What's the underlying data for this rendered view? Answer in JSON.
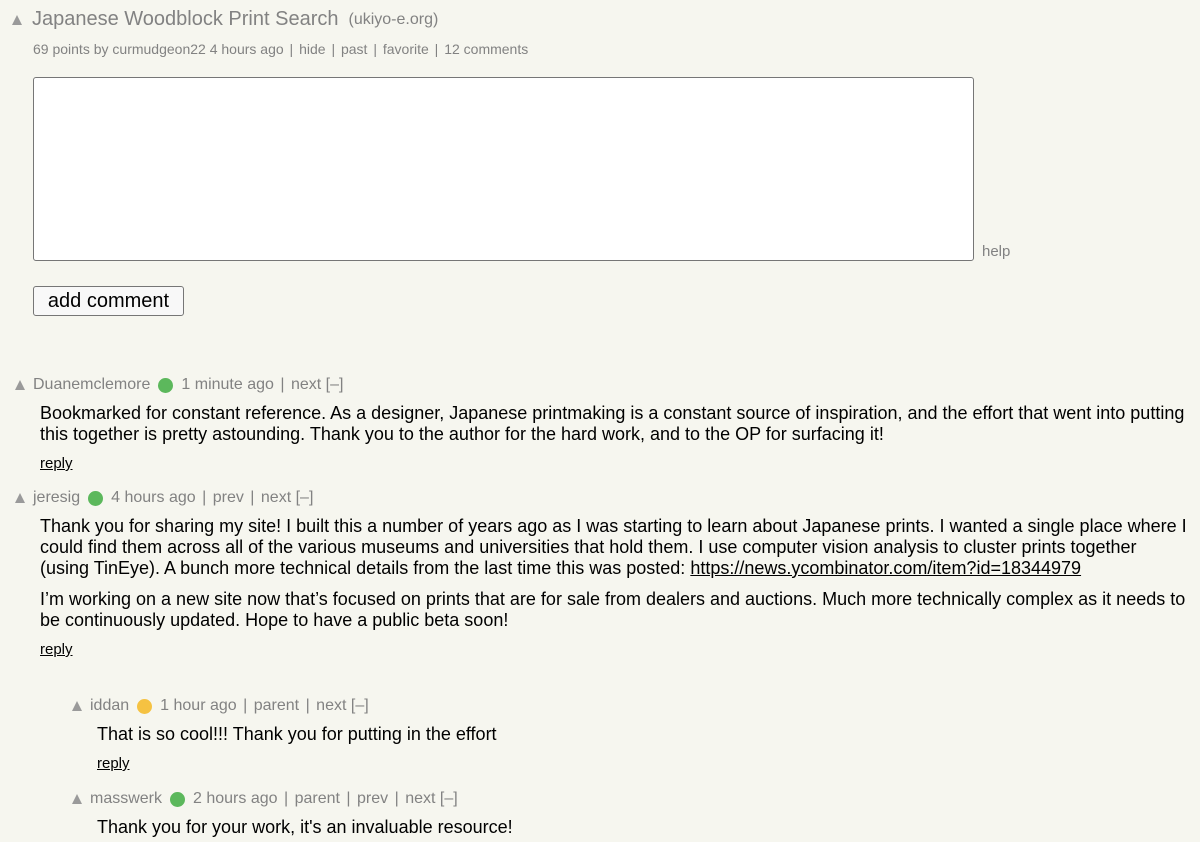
{
  "story": {
    "title": "Japanese Woodblock Print Search",
    "domain": "(ukiyo-e.org)",
    "points": "69 points",
    "by_label": "by",
    "author": "curmudgeon22",
    "age": "4 hours ago",
    "links": [
      "hide",
      "past",
      "favorite",
      "12 comments"
    ]
  },
  "form": {
    "textarea_value": "",
    "help_label": "help",
    "submit_label": "add comment"
  },
  "comments": [
    {
      "user": "Duanemclemore",
      "dot_color": "#5cb85c",
      "age": "1 minute ago",
      "nav": [
        "next",
        "[–]"
      ],
      "paragraphs": [
        "Bookmarked for constant reference. As a designer, Japanese printmaking is a constant source of inspiration, and the effort that went into putting this together is pretty astounding. Thank you to the author for the hard work, and to the OP for surfacing it!"
      ],
      "reply": "reply"
    },
    {
      "user": "jeresig",
      "dot_color": "#5cb85c",
      "age": "4 hours ago",
      "nav": [
        "prev",
        "next",
        "[–]"
      ],
      "paragraph1": "Thank you for sharing my site! I built this a number of years ago as I was starting to learn about Japanese prints. I wanted a single place where I could find them across all of the various museums and universities that hold them. I use computer vision analysis to cluster prints together (using TinEye). A bunch more technical details from the last time this was posted:",
      "link": "https://news.ycombinator.com/item?id=18344979",
      "paragraph2": "I’m working on a new site now that’s focused on prints that are for sale from dealers and auctions. Much more technically complex as it needs to be continuously updated. Hope to have a public beta soon!",
      "reply": "reply"
    },
    {
      "user": "iddan",
      "dot_color": "#f5c242",
      "age": "1 hour ago",
      "nav": [
        "parent",
        "next",
        "[–]"
      ],
      "paragraphs": [
        "That is so cool!!! Thank you for putting in the effort"
      ],
      "reply": "reply"
    },
    {
      "user": "masswerk",
      "dot_color": "#5cb85c",
      "age": "2 hours ago",
      "nav": [
        "parent",
        "prev",
        "next",
        "[–]"
      ],
      "paragraphs": [
        "Thank you for your work, it's an invaluable resource!"
      ]
    }
  ]
}
